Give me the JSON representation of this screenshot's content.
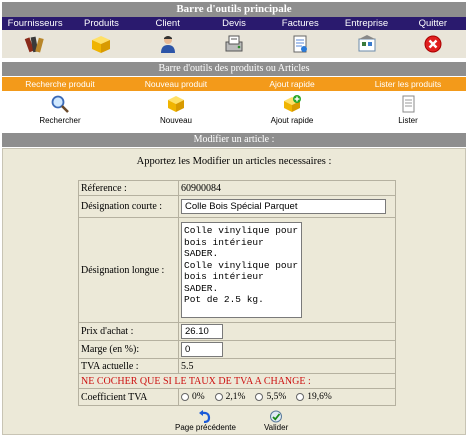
{
  "main_toolbar": {
    "title": "Barre d'outils principale",
    "items": [
      {
        "label": "Fournisseurs",
        "icon": "books-icon"
      },
      {
        "label": "Produits",
        "icon": "box-icon"
      },
      {
        "label": "Client",
        "icon": "person-icon"
      },
      {
        "label": "Devis",
        "icon": "quote-icon"
      },
      {
        "label": "Factures",
        "icon": "invoice-icon"
      },
      {
        "label": "Entreprise",
        "icon": "company-icon"
      },
      {
        "label": "Quitter",
        "icon": "close-icon"
      }
    ]
  },
  "product_toolbar": {
    "title": "Barre d'outils des produits ou Articles",
    "items": [
      {
        "label": "Recherche produit"
      },
      {
        "label": "Nouveau produit"
      },
      {
        "label": "Ajout rapide"
      },
      {
        "label": "Lister les produits"
      }
    ],
    "tools": [
      {
        "label": "Rechercher",
        "icon": "magnifier-icon"
      },
      {
        "label": "Nouveau",
        "icon": "new-box-icon"
      },
      {
        "label": "Ajout rapide",
        "icon": "quick-add-icon"
      },
      {
        "label": "Lister",
        "icon": "list-icon"
      }
    ]
  },
  "form": {
    "title": "Modifier un article :",
    "intro": "Apportez les Modifier un articles necessaires :",
    "reference_label": "Réference :",
    "reference_value": "60900084",
    "short_label": "Désignation courte :",
    "short_value": "Colle Bois Spécial Parquet",
    "long_label": "Désignation longue :",
    "long_value": "Colle vinylique pour\nbois intérieur SADER.\nColle vinylique pour\nbois intérieur SADER.\nPot de 2.5 kg.",
    "price_label": "Prix d'achat :",
    "price_value": "26.10",
    "margin_label": "Marge (en %):",
    "margin_value": "0",
    "vat_label": "TVA actuelle :",
    "vat_value": "5.5",
    "warning": "NE COCHER QUE SI LE TAUX DE TVA A CHANGE :",
    "coef_label": "Coefficient TVA",
    "coef_options": [
      "0%",
      "2,1%",
      "5,5%",
      "19,6%"
    ]
  },
  "footer": {
    "back_label": "Page précédente",
    "validate_label": "Valider"
  },
  "colors": {
    "title_bar": "#8e8e8e",
    "main_nav": "#2a1a6e",
    "sub_nav": "#f39a1a",
    "panel": "#ece9d8",
    "warning": "#cc1111"
  }
}
